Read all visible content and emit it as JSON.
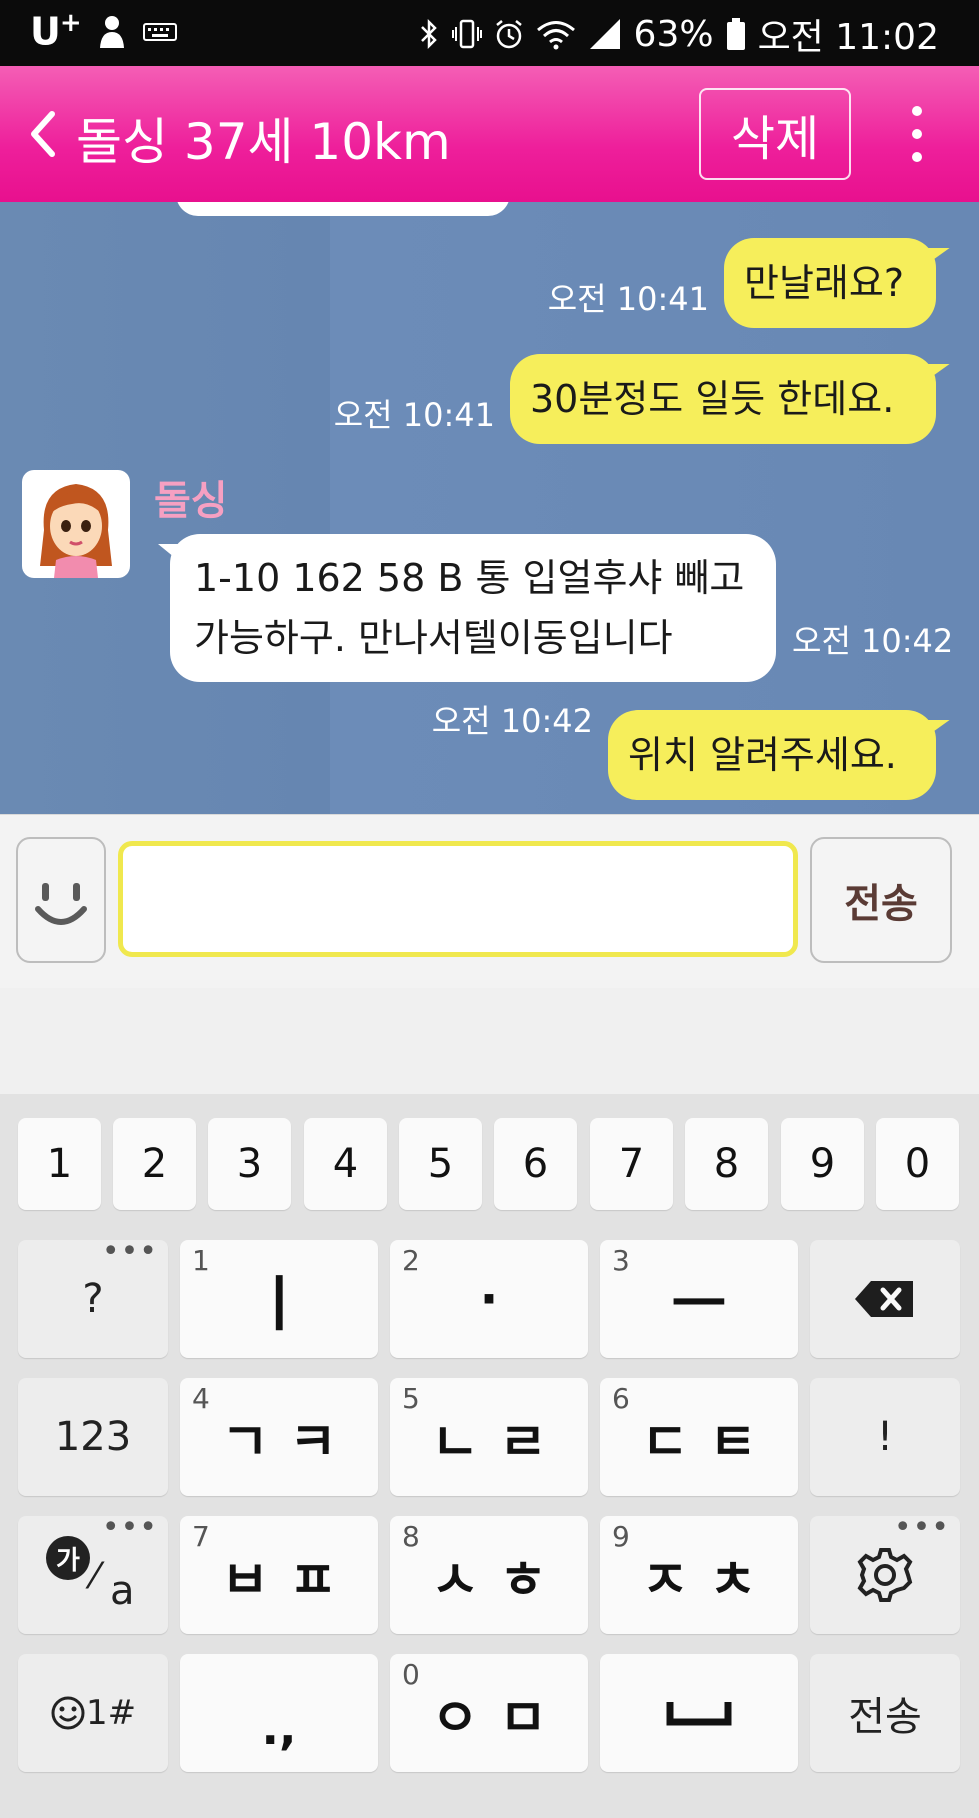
{
  "status_bar": {
    "carrier": "U",
    "carrier_sup": "+",
    "battery_percent": "63%",
    "time": "오전 11:02",
    "icons": [
      "person-icon",
      "keyboard-icon",
      "bluetooth-icon",
      "vibrate-icon",
      "alarm-icon",
      "wifi-icon",
      "signal-icon",
      "battery-icon"
    ]
  },
  "header": {
    "title": "돌싱 37세 10km",
    "delete_label": "삭제"
  },
  "messages": [
    {
      "from": "me",
      "text": "만날래요?",
      "time": "오전 10:41"
    },
    {
      "from": "me",
      "text": "30분정도 일듯 한데요.",
      "time": "오전 10:41"
    },
    {
      "from": "them",
      "sender": "돌싱",
      "lines": [
        "1-10 162 58 B 통 입얼후샤 빼고",
        "가능하구. 만나서텔이동입니다"
      ],
      "time": "오전 10:42"
    },
    {
      "from": "me",
      "text": "위치 알려주세요.",
      "time": "오전 10:42"
    }
  ],
  "input": {
    "value": "",
    "send_label": "전송"
  },
  "keyboard": {
    "number_row": [
      "1",
      "2",
      "3",
      "4",
      "5",
      "6",
      "7",
      "8",
      "9",
      "0"
    ],
    "row1": {
      "left": "?",
      "k1_num": "1",
      "k1": "ㅣ",
      "k2_num": "2",
      "k2": "·",
      "k3_num": "3",
      "k3": "ㅡ"
    },
    "row2": {
      "left": "123",
      "k1_num": "4",
      "k1": "ㄱㅋ",
      "k2_num": "5",
      "k2": "ㄴㄹ",
      "k3_num": "6",
      "k3": "ㄷㅌ",
      "right": "!"
    },
    "row3": {
      "lang_circle": "가",
      "lang_rest": "a",
      "k1_num": "7",
      "k1": "ㅂㅍ",
      "k2_num": "8",
      "k2": "ㅅㅎ",
      "k3_num": "9",
      "k3": "ㅈㅊ"
    },
    "row4": {
      "left": "1#",
      "k1": ".,",
      "k2_num": "0",
      "k2": "ㅇㅁ",
      "right": "전송"
    },
    "more_dots": "•••"
  }
}
